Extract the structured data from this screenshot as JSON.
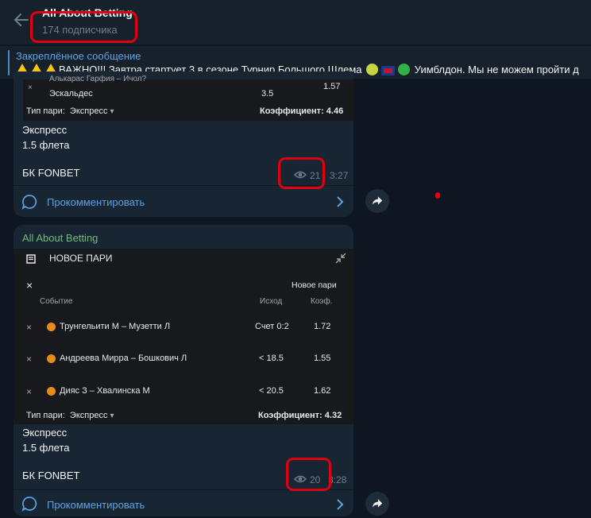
{
  "channel": {
    "title": "All About Betting",
    "subscribers": "174 подписчика"
  },
  "pinned": {
    "label": "Закреплённое сообщение",
    "text_a": "ВАЖНО!!! Завтра стартует 3 в сезоне Турнир Большого Шлема",
    "text_b": "Уимблдон. Мы не можем пройти д"
  },
  "post1": {
    "partial_top_text": "Алькарас Гарфия – Ичол?",
    "partial_outcome": "3.5",
    "partial_odds": "1.57",
    "partial_player": "Эскальдес",
    "bet_type_label": "Тип пари:",
    "bet_type_value": "Экспресс",
    "coef_label": "Коэффициент:",
    "coef_value": "4.46",
    "text_line1": "Экспресс",
    "text_line2": "1.5 флета",
    "bookmaker": "БК FONBET",
    "views": "21",
    "time": "3:27",
    "comment": "Прокомментировать"
  },
  "post2": {
    "author": "All About Betting",
    "slip_title": "НОВОЕ ПАРИ",
    "slip_new": "Новое пари",
    "col_event": "Событие",
    "col_outcome": "Исход",
    "col_odds": "Коэф.",
    "rows": [
      {
        "event": "Трунгельити М – Музетти Л",
        "outcome": "Счет 0:2",
        "odds": "1.72"
      },
      {
        "event": "Андреева Мирра – Бошкович Л",
        "outcome": "< 18.5",
        "odds": "1.55"
      },
      {
        "event": "Дияс З – Хвалинска М",
        "outcome": "< 20.5",
        "odds": "1.62"
      }
    ],
    "bet_type_label": "Тип пари:",
    "bet_type_value": "Экспресс",
    "coef_label": "Коэффициент:",
    "coef_value": "4.32",
    "text_line1": "Экспресс",
    "text_line2": "1.5 флета",
    "bookmaker": "БК FONBET",
    "views": "20",
    "time": "3:28",
    "comment": "Прокомментировать"
  },
  "colors": {
    "bg": "#0e1621",
    "bubble": "#182533",
    "accent": "#5ea2e0",
    "author": "#6fbd76",
    "highlight": "#e0000f"
  }
}
